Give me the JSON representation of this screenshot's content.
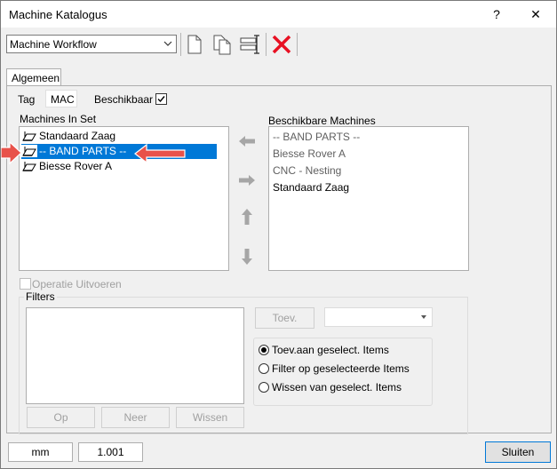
{
  "window": {
    "title": "Machine Katalogus",
    "help_label": "?",
    "close_label": "✕"
  },
  "toolbar": {
    "workflow_combo_value": "Machine Workflow",
    "tools": [
      "new-document-icon",
      "copy-document-icon",
      "edit-fields-icon",
      "delete-icon"
    ]
  },
  "tabs": [
    {
      "label": "Algemeen"
    }
  ],
  "general": {
    "tag_label": "Tag",
    "tag_value": "MAC",
    "available_label": "Beschikbaar",
    "available_checked": true
  },
  "machines_in_set": {
    "label": "Machines In Set",
    "items": [
      {
        "label": "Standaard Zaag",
        "selected": false
      },
      {
        "label": "-- BAND PARTS --",
        "selected": true
      },
      {
        "label": "Biesse Rover A",
        "selected": false
      }
    ]
  },
  "available_machines": {
    "label": "Beschikbare Machines",
    "items": [
      {
        "label": "-- BAND PARTS --",
        "enabled": false
      },
      {
        "label": "Biesse Rover A",
        "enabled": false
      },
      {
        "label": "CNC - Nesting",
        "enabled": false
      },
      {
        "label": "Standaard Zaag",
        "enabled": true
      }
    ]
  },
  "operation": {
    "label": "Operatie Uitvoeren",
    "checked": false
  },
  "filters": {
    "label": "Filters",
    "add_label": "Toev.",
    "combo_value": "",
    "up_label": "Op",
    "down_label": "Neer",
    "clear_label": "Wissen",
    "radio_options": [
      {
        "label": "Toev.aan geselect. Items",
        "checked": true
      },
      {
        "label": "Filter op geselecteerde Items",
        "checked": false
      },
      {
        "label": "Wissen van geselect. Items",
        "checked": false
      }
    ]
  },
  "footer": {
    "unit": "mm",
    "version": "1.001",
    "close_label": "Sluiten"
  },
  "colors": {
    "selection": "#0078d7",
    "annotation_arrow": "#e8524a",
    "delete_red": "#e81123"
  }
}
